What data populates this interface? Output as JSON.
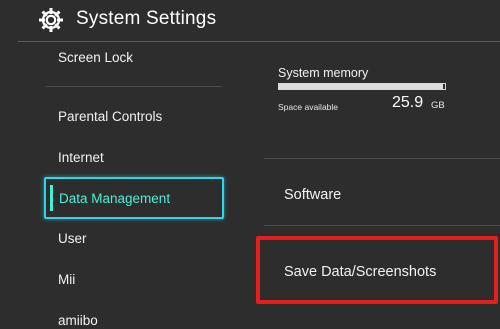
{
  "header": {
    "title": "System Settings",
    "icon": "gear-icon"
  },
  "sidebar": {
    "items": [
      {
        "label": "Screen Lock"
      },
      {
        "label": "Parental Controls"
      },
      {
        "label": "Internet"
      },
      {
        "label": "Data Management",
        "selected": true
      },
      {
        "label": "User"
      },
      {
        "label": "Mii"
      },
      {
        "label": "amiibo"
      }
    ]
  },
  "memory": {
    "title": "System memory",
    "space_label": "Space available",
    "space_value": "25.9",
    "space_unit": "GB",
    "used_fraction": 0.99
  },
  "options": {
    "software": "Software",
    "save_data": "Save Data/Screenshots"
  },
  "colors": {
    "selected_accent": "#2fd6e8",
    "highlight_box": "#e3211c",
    "background": "#2d2d2d"
  }
}
